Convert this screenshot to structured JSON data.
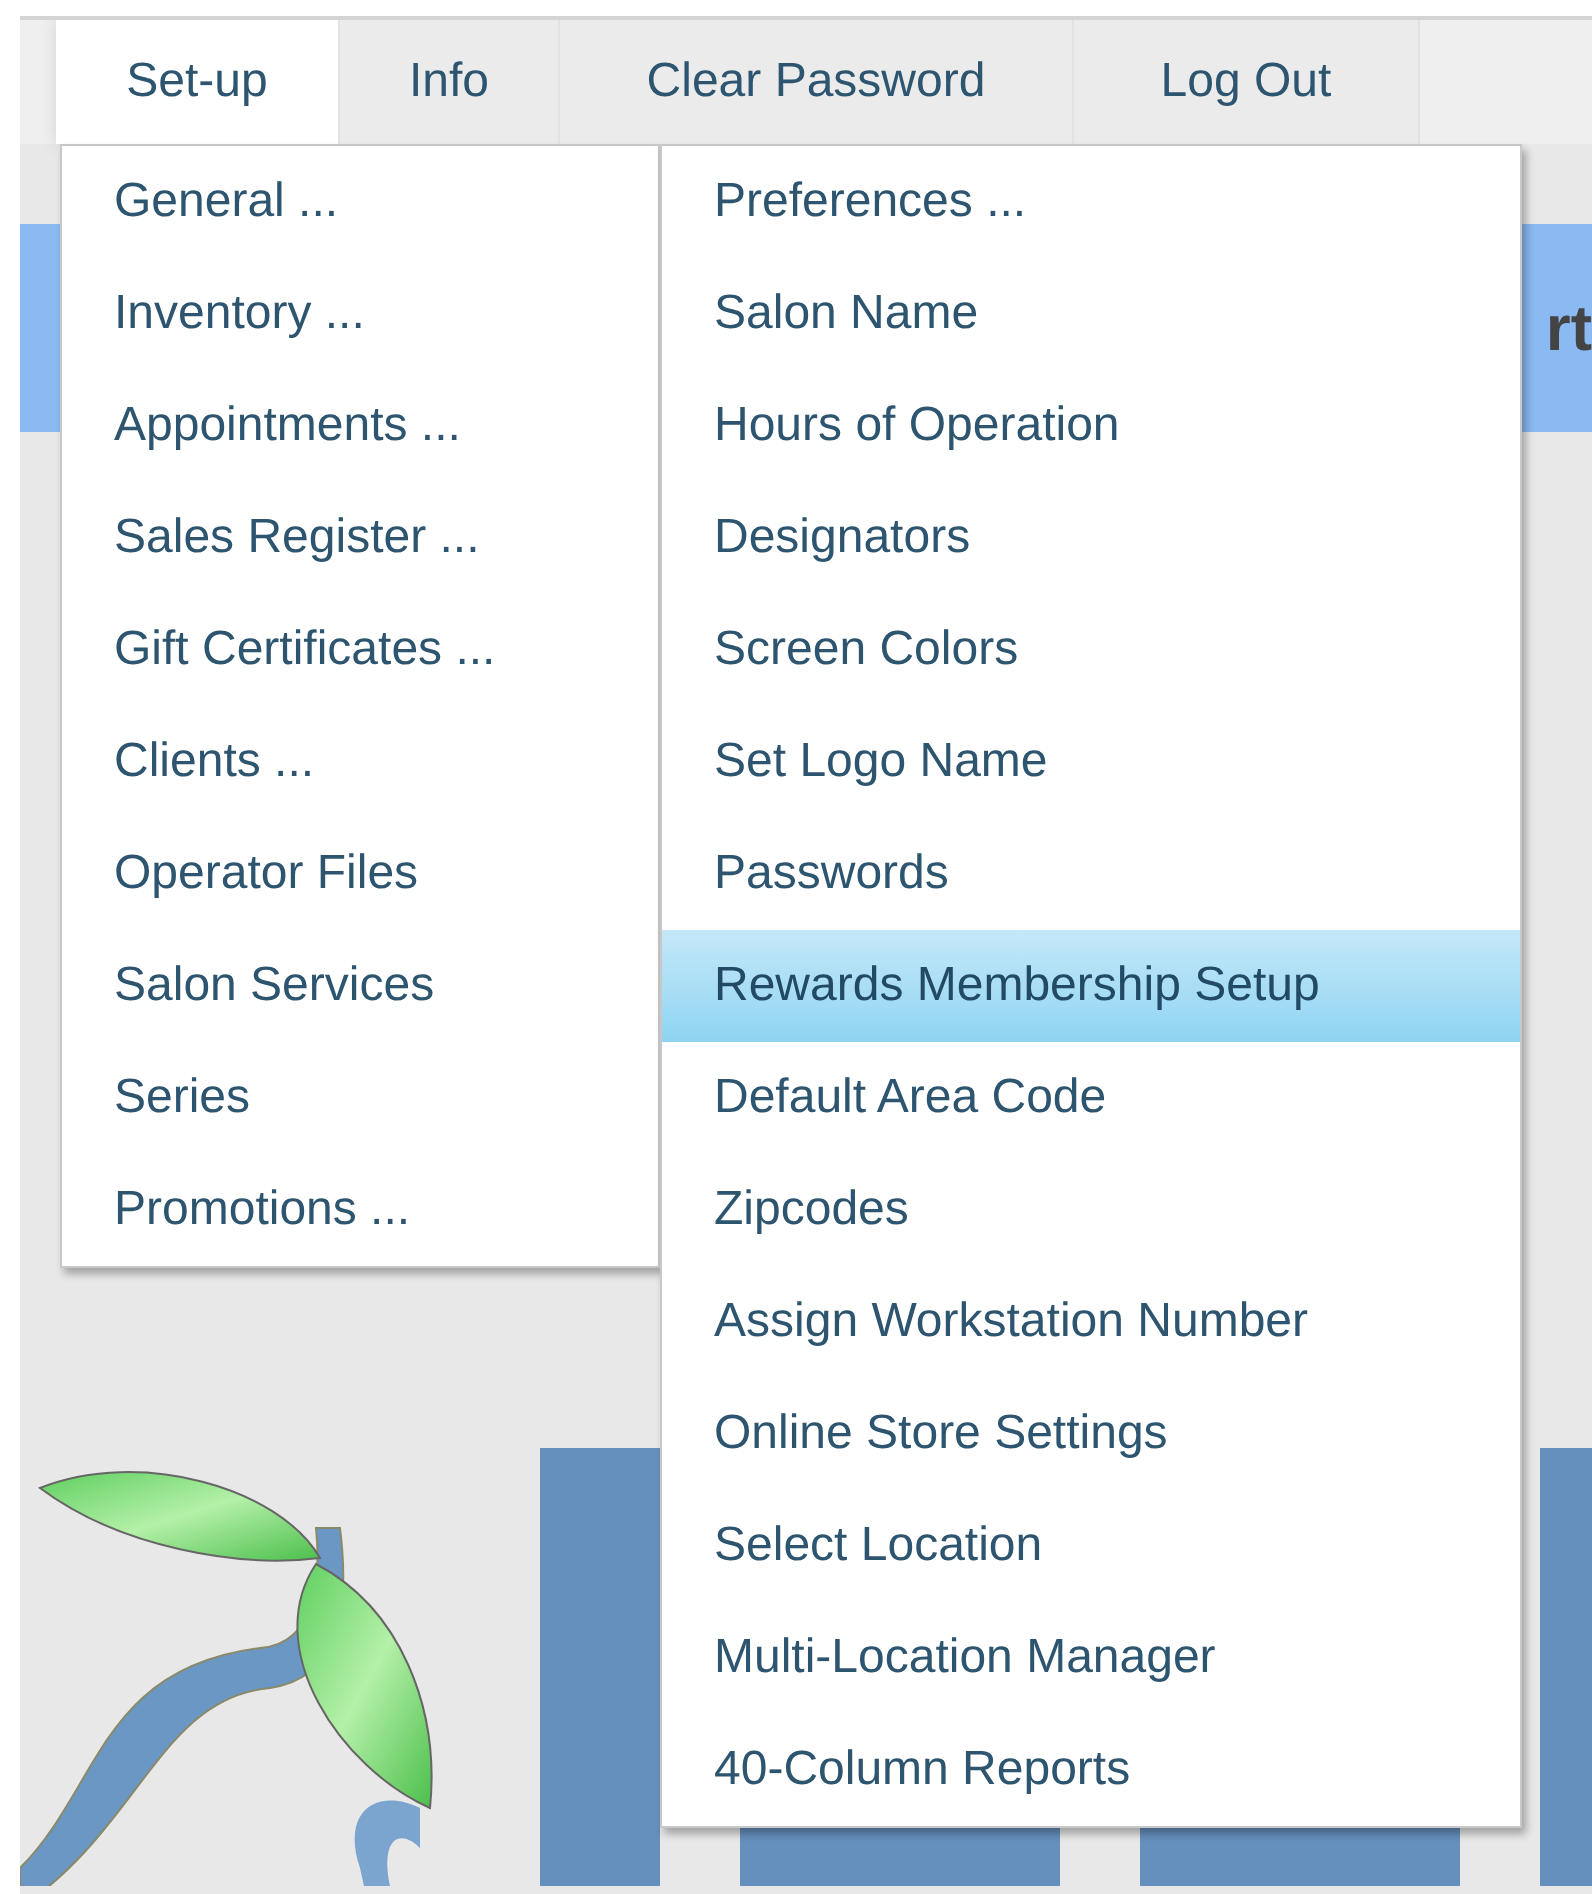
{
  "menu_bar": {
    "tabs": [
      {
        "label": "Set-up",
        "selected": true
      },
      {
        "label": "Info",
        "selected": false
      },
      {
        "label": "Clear Password",
        "selected": false
      },
      {
        "label": "Log Out",
        "selected": false
      }
    ]
  },
  "banner": {
    "text": "rt"
  },
  "setup_menu": {
    "items": [
      {
        "label": "General ..."
      },
      {
        "label": "Inventory ..."
      },
      {
        "label": "Appointments ..."
      },
      {
        "label": "Sales Register ..."
      },
      {
        "label": "Gift Certificates ..."
      },
      {
        "label": "Clients ..."
      },
      {
        "label": "Operator Files"
      },
      {
        "label": "Salon Services"
      },
      {
        "label": "Series"
      },
      {
        "label": "Promotions ..."
      }
    ]
  },
  "general_submenu": {
    "items": [
      {
        "label": "Preferences ...",
        "selected": false
      },
      {
        "label": "Salon Name",
        "selected": false
      },
      {
        "label": "Hours of Operation",
        "selected": false
      },
      {
        "label": "Designators",
        "selected": false
      },
      {
        "label": "Screen Colors",
        "selected": false
      },
      {
        "label": "Set Logo Name",
        "selected": false
      },
      {
        "label": "Passwords",
        "selected": false
      },
      {
        "label": "Rewards Membership Setup",
        "selected": true
      },
      {
        "label": "Default Area Code",
        "selected": false
      },
      {
        "label": "Zipcodes",
        "selected": false
      },
      {
        "label": "Assign Workstation Number",
        "selected": false
      },
      {
        "label": "Online Store Settings",
        "selected": false
      },
      {
        "label": "Select Location",
        "selected": false
      },
      {
        "label": "Multi-Location Manager",
        "selected": false
      },
      {
        "label": "40-Column Reports",
        "selected": false
      }
    ]
  }
}
